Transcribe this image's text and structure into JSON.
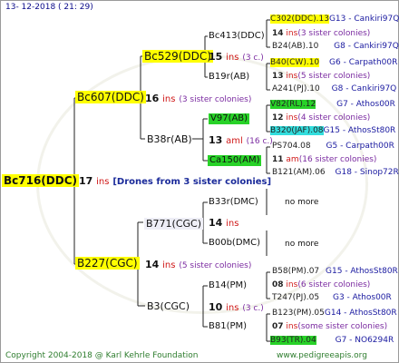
{
  "header": {
    "date": "13- 12-2018 ( 21: 29)"
  },
  "root": {
    "label": "Bc716(DDC)",
    "count": "17",
    "ins": "ins",
    "drones_text": "[Drones from 3 sister colonies]"
  },
  "gen1": [
    {
      "label": "Bc607(DDC)",
      "count": "16",
      "ins": "ins",
      "sis": "(3 sister colonies)"
    },
    {
      "label": "B227(CGC)",
      "count": "14",
      "ins": "ins",
      "sis": "(5 sister colonies)"
    }
  ],
  "gen2": [
    {
      "label": "Bc529(DDC)",
      "count": "15",
      "ins": "ins",
      "sis": "(3 c.)"
    },
    {
      "label": "B38r(AB)",
      "count": "13",
      "ins": "aml",
      "sis": "(16 c.)"
    },
    {
      "label": "B771(CGC)",
      "count": "14",
      "ins": "ins",
      "sis": ""
    },
    {
      "label": "B3(CGC)",
      "count": "10",
      "ins": "ins",
      "sis": "(3 c.)"
    }
  ],
  "gen3": [
    {
      "label": "Bc413(DDC)"
    },
    {
      "label": "B19r(AB)"
    },
    {
      "label": "V97(AB)"
    },
    {
      "label": "Ca150(AM)"
    },
    {
      "label": "B33r(DMC)"
    },
    {
      "label": "B00b(DMC)"
    },
    {
      "label": "B14(PM)"
    },
    {
      "label": "B81(PM)"
    }
  ],
  "gen4": [
    {
      "top": "C302(DDC).13",
      "top_loc": "G13 - Cankiri97Q",
      "count": "14",
      "ins": "ins",
      "sis": "(3 sister colonies)",
      "bottom": "B24(AB).10",
      "bottom_loc": "G8 - Cankiri97Q"
    },
    {
      "top": "B40(CW).10",
      "top_loc": "G6 - Carpath00R",
      "count": "13",
      "ins": "ins",
      "sis": "(5 sister colonies)",
      "bottom": "A241(PJ).10",
      "bottom_loc": "G8 - Cankiri97Q"
    },
    {
      "top": "V82(RL).12",
      "top_loc": "G7 - Athos00R",
      "count": "12",
      "ins": "ins",
      "sis": "(4 sister colonies)",
      "bottom": "B320(JAF).08",
      "bottom_loc": "G15 - AthosSt80R"
    },
    {
      "top": "PS704.08",
      "top_loc": "G5 - Carpath00R",
      "count": "11",
      "ins": "am",
      "sis": "(16 sister colonies)",
      "bottom": "B121(AM).06",
      "bottom_loc": "G18 - Sinop72R"
    },
    {
      "more": "no more"
    },
    {
      "more": "no more"
    },
    {
      "top": "B58(PM).07",
      "top_loc": "G15 - AthosSt80R",
      "count": "08",
      "ins": "ins",
      "sis": "(6 sister colonies)",
      "bottom": "T247(PJ).05",
      "bottom_loc": "G3 - Athos00R"
    },
    {
      "top": "B123(PM).05",
      "top_loc": "G14 - AthosSt80R",
      "count": "07",
      "ins": "ins",
      "sis": "(some sister colonies)",
      "bottom": "B93(TR).04",
      "bottom_loc": "G7 - NO6294R"
    }
  ],
  "footer": {
    "copyright": "Copyright 2004-2018 @ Karl Kehrle Foundation",
    "site": "www.pedigreeapis.org"
  },
  "colors": {
    "queen_highlight": "#ffff00",
    "green_highlight": "#28d228",
    "cyan_highlight": "#33dddd",
    "ins_red": "#d01818",
    "sister_purple": "#7a2aa0",
    "footer_green": "#2e7d2e"
  }
}
